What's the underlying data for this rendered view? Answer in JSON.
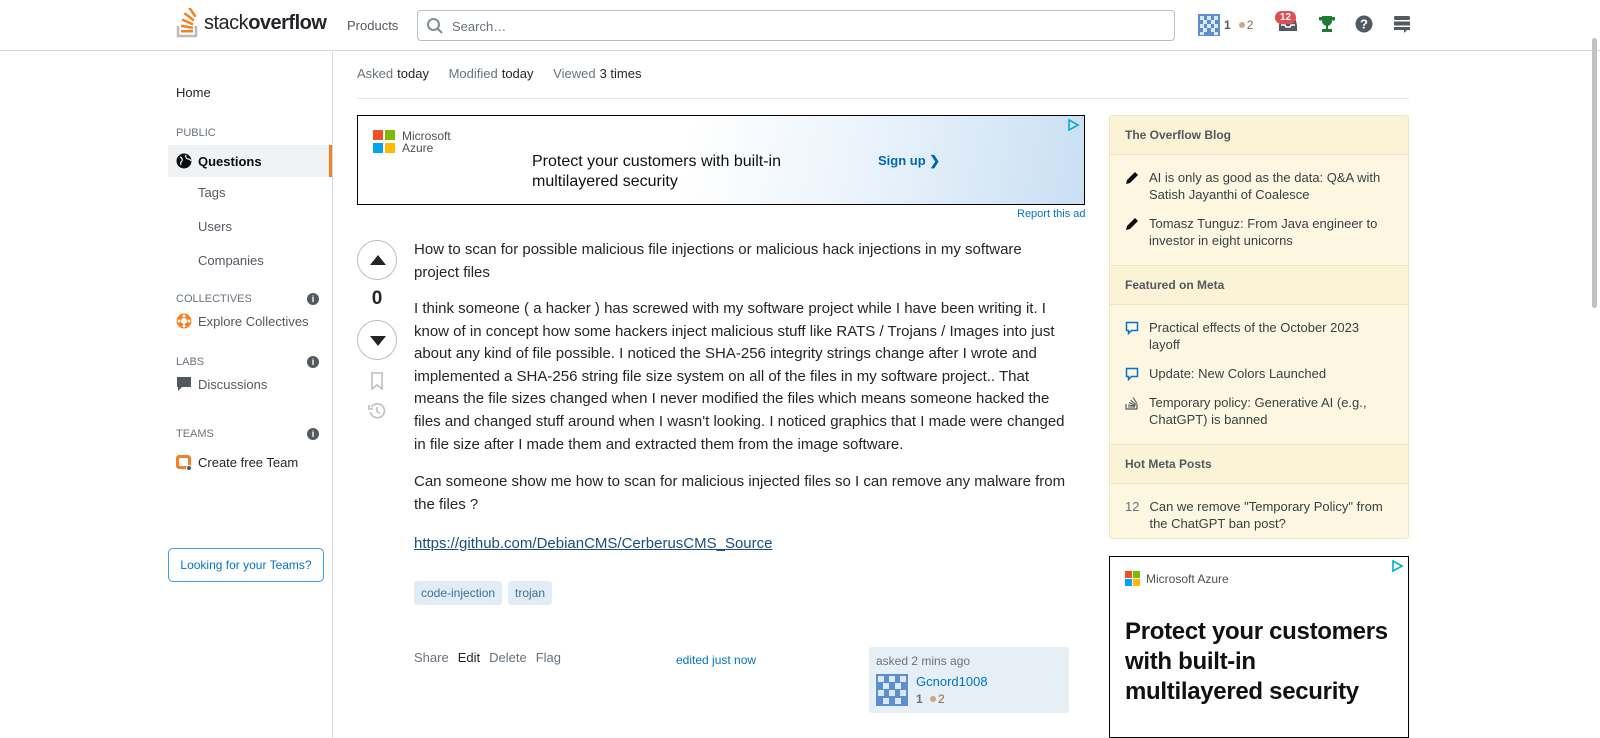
{
  "header": {
    "logo_plain": "stack",
    "logo_bold": "overflow",
    "products": "Products",
    "search_placeholder": "Search…",
    "reputation": "1",
    "bronze_badges": "2",
    "inbox_count": "12"
  },
  "nav": {
    "home": "Home",
    "public": "PUBLIC",
    "questions": "Questions",
    "tags": "Tags",
    "users": "Users",
    "companies": "Companies",
    "collectives": "COLLECTIVES",
    "explore_collectives": "Explore Collectives",
    "labs": "LABS",
    "discussions": "Discussions",
    "teams": "TEAMS",
    "create_team": "Create free Team",
    "looking_for_teams": "Looking for your Teams?"
  },
  "question_meta": {
    "asked_label": "Asked",
    "asked_value": "today",
    "modified_label": "Modified",
    "modified_value": "today",
    "viewed_label": "Viewed",
    "viewed_value": "3 times"
  },
  "ad_banner": {
    "brand_line1": "Microsoft",
    "brand_line2": "Azure",
    "headline": "Protect your customers with built-in multilayered security",
    "cta": "Sign up ❯",
    "report": "Report this ad"
  },
  "question": {
    "score": "0",
    "title": "How to scan for possible malicious file injections or malicious hack injections in my software project files",
    "paragraph1": "I think someone ( a hacker ) has screwed with my software project while I have been writing it. I know of in concept how some hackers inject malicious stuff like RATS / Trojans / Images into just about any kind of file possible. I noticed the SHA-256 integrity strings change after I wrote and implemented a SHA-256 string file size system on all of the files in my software project.. That means the file sizes changed when I never modified the files which means someone hacked the files and changed stuff around when I wasn't looking. I noticed graphics that I made were changed in file size after I made them and extracted them from the image software.",
    "paragraph2": "Can someone show me how to scan for malicious injected files so I can remove any malware from the files ?",
    "link": "https://github.com/DebianCMS/CerberusCMS_Source",
    "tags": [
      "code-injection",
      "trojan"
    ],
    "menu": {
      "share": "Share",
      "edit": "Edit",
      "delete": "Delete",
      "flag": "Flag"
    },
    "edited": "edited just now",
    "asked_time": "asked 2 mins ago",
    "author": "Gcnord1008",
    "author_rep": "1",
    "author_bronze": "2"
  },
  "sidebar": {
    "blog_title": "The Overflow Blog",
    "blog_items": [
      "AI is only as good as the data: Q&A with Satish Jayanthi of Coalesce",
      "Tomasz Tunguz: From Java engineer to investor in eight unicorns"
    ],
    "meta_title": "Featured on Meta",
    "meta_items": [
      "Practical effects of the October 2023 layoff",
      "Update: New Colors Launched",
      "Temporary policy: Generative AI (e.g., ChatGPT) is banned"
    ],
    "hot_title": "Hot Meta Posts",
    "hot_items": [
      {
        "count": "12",
        "text": "Can we remove \"Temporary Policy\" from the ChatGPT ban post?"
      }
    ]
  },
  "ad_side": {
    "brand": "Microsoft Azure",
    "headline": "Protect your customers with built-in multilayered security"
  },
  "colors": {
    "accent_orange": "#f48225",
    "link_blue": "#0074cc",
    "tag_bg": "#e1ecf4",
    "sidebar_bg": "#fdf7e2",
    "inbox_badge": "#de4f54"
  }
}
